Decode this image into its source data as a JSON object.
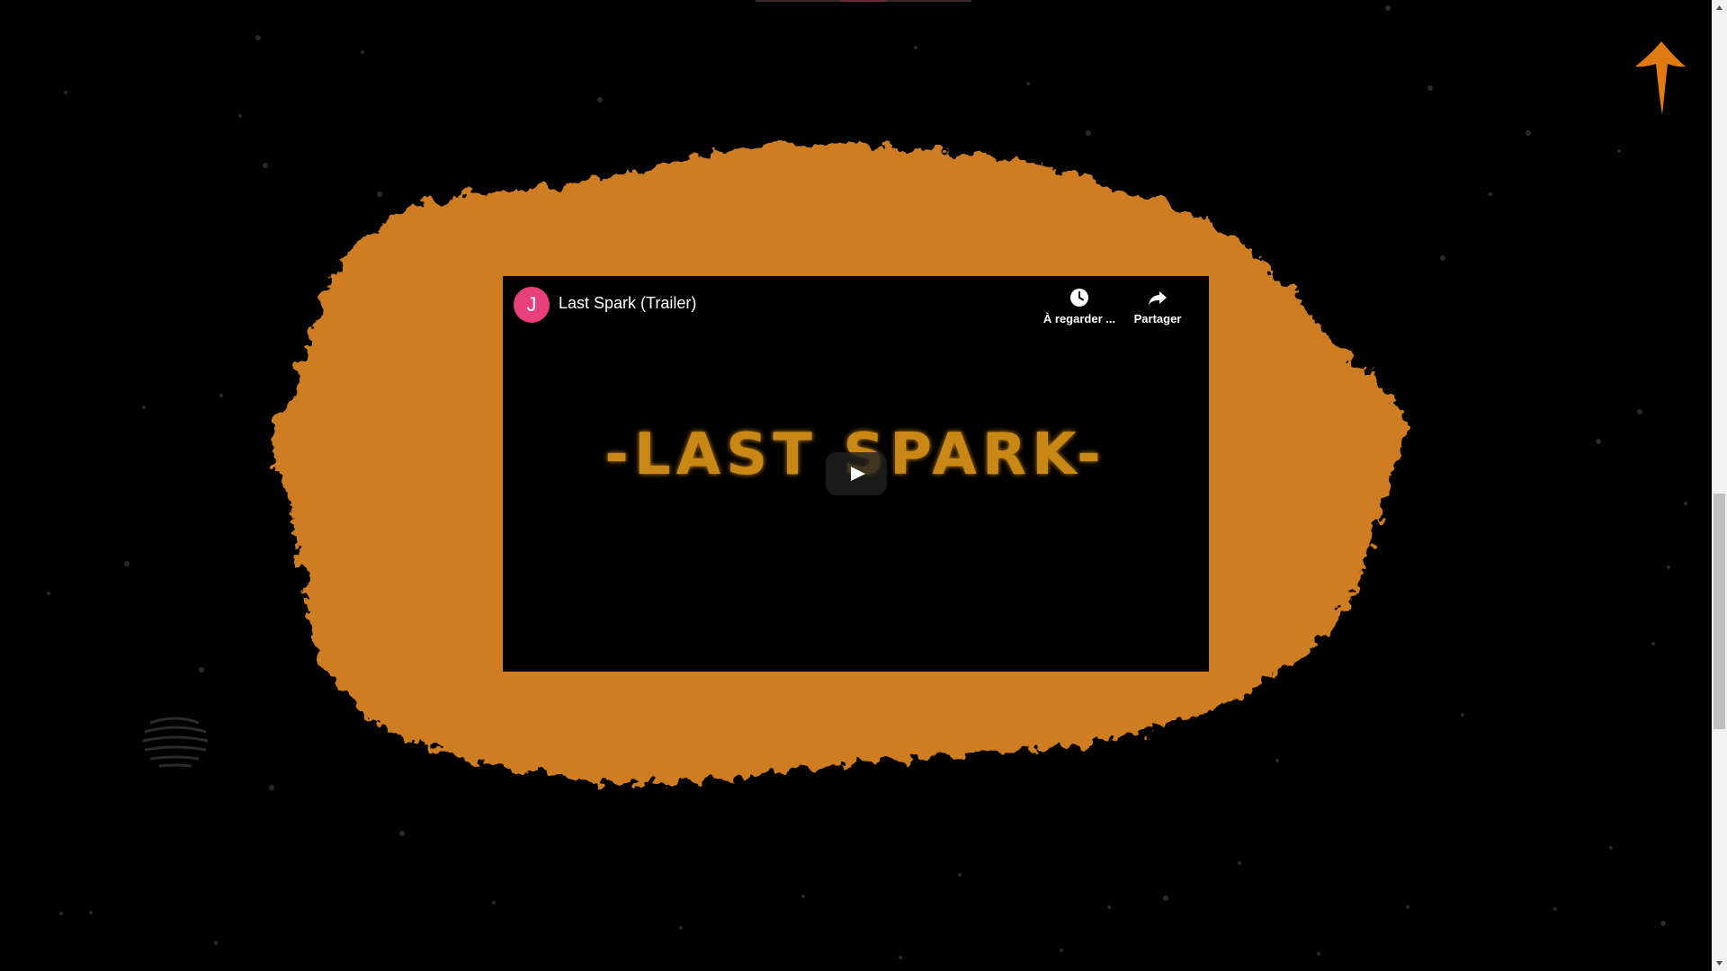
{
  "video": {
    "channel_initial": "J",
    "title": "Last Spark (Trailer)",
    "watch_later_label": "À regarder ...",
    "share_label": "Partager",
    "logo_text": "-LAST SPARK-"
  },
  "colors": {
    "background": "#000000",
    "splash_orange": "#d07e20",
    "logo_orange": "#c98716",
    "arrow_orange": "#e07a12",
    "avatar_pink": "#e8407a"
  },
  "icons": {
    "back_to_top": "arrow-up-icon",
    "watch_later": "clock-icon",
    "share": "share-arrow-icon",
    "play": "play-icon"
  }
}
